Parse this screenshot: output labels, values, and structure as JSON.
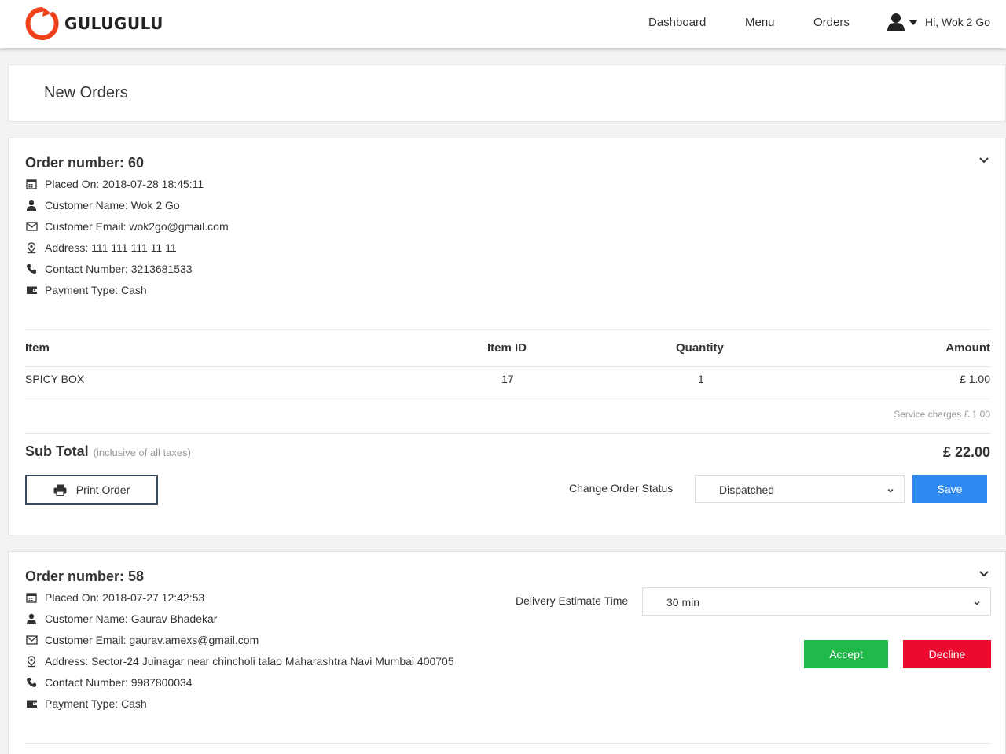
{
  "header": {
    "brand": "GULUGULU",
    "brand_color": "#f0411a",
    "nav": [
      "Dashboard",
      "Menu",
      "Orders"
    ],
    "user_greeting": "Hi, Wok 2 Go"
  },
  "page": {
    "title": "New Orders"
  },
  "orders": [
    {
      "title": "Order number: 60",
      "placed_on": "Placed On: 2018-07-28 18:45:11",
      "customer_name": "Customer Name: Wok 2 Go",
      "customer_email": "Customer Email: wok2go@gmail.com",
      "address": "Address: 111 111 111 11 11",
      "contact": "Contact Number: 3213681533",
      "payment": "Payment Type: Cash",
      "table": {
        "headers": [
          "Item",
          "Item ID",
          "Quantity",
          "Amount"
        ],
        "rows": [
          [
            "SPICY BOX",
            "17",
            "1",
            "£ 1.00"
          ]
        ]
      },
      "service_charges": "Service charges £ 1.00",
      "subtotal_label": "Sub Total",
      "subtotal_note": "(inclusive of all taxes)",
      "subtotal_amount": "£ 22.00",
      "print_label": "Print Order",
      "status_label": "Change Order Status",
      "status_value": "Dispatched",
      "save_label": "Save"
    },
    {
      "title": "Order number: 58",
      "placed_on": "Placed On: 2018-07-27 12:42:53",
      "customer_name": "Customer Name: Gaurav Bhadekar",
      "customer_email": "Customer Email: gaurav.amexs@gmail.com",
      "address": "Address: Sector-24 Juinagar near chincholi talao Maharashtra Navi Mumbai 400705",
      "contact": "Contact Number: 9987800034",
      "payment": "Payment Type: Cash",
      "estimate_label": "Delivery Estimate Time",
      "estimate_value": "30 min",
      "accept_label": "Accept",
      "decline_label": "Decline"
    }
  ],
  "colors": {
    "save": "#2e89f0",
    "accept": "#1fba4a",
    "decline": "#ee0a2e"
  },
  "icons": [
    "calendar-icon",
    "user-icon",
    "envelope-icon",
    "map-marker-icon",
    "phone-icon",
    "wallet-icon",
    "print-icon",
    "chevron-down-icon"
  ]
}
